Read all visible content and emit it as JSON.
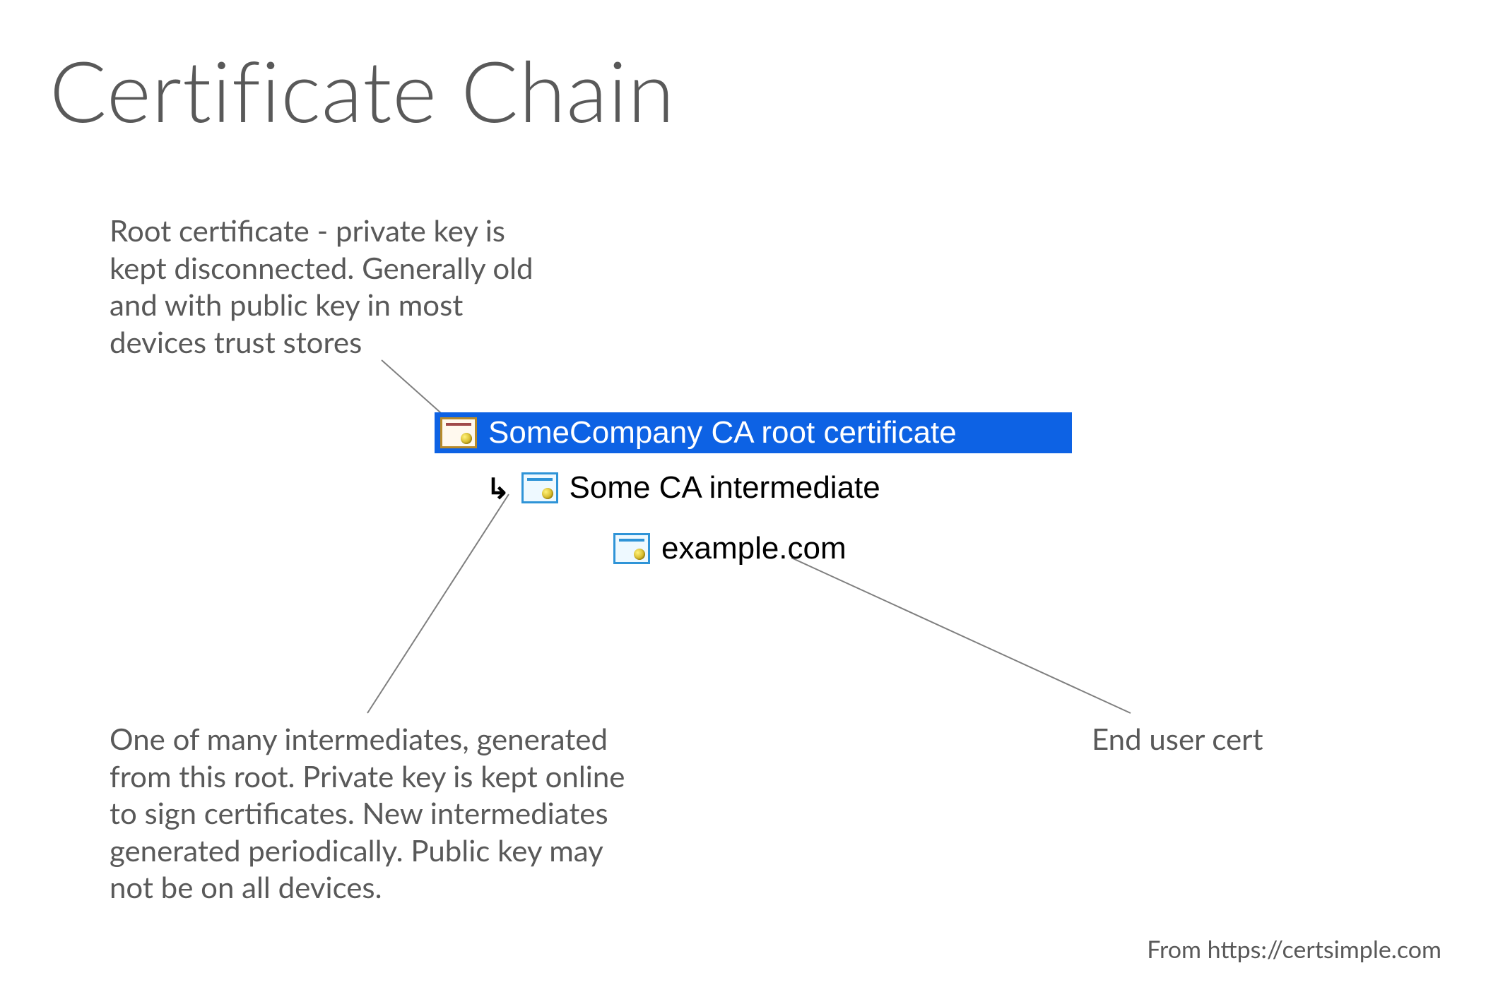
{
  "title": "Certificate Chain",
  "annotations": {
    "root": "Root certificate - private key is kept disconnected. Generally old and with public key in most devices trust stores",
    "intermediate": "One of many intermediates, generated from this root. Private key is kept online to sign certificates. New intermediates generated periodically. Public key may not be on all devices.",
    "end": "End user cert"
  },
  "chain": {
    "root": "SomeCompany CA root certificate",
    "intermediate": "Some CA intermediate",
    "leaf": "example.com"
  },
  "attribution": "From https://certsimple.com"
}
